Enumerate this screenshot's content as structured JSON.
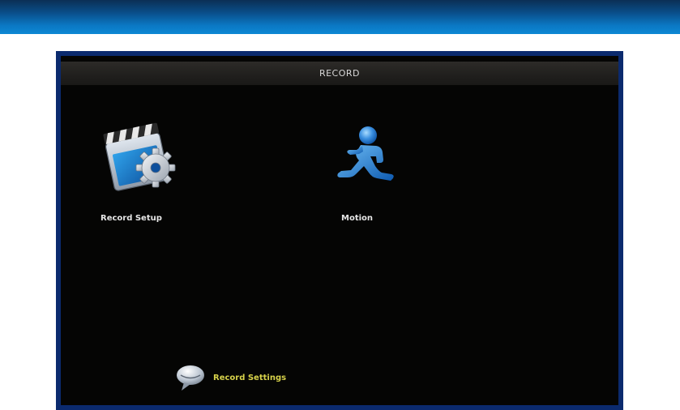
{
  "window": {
    "title": "RECORD"
  },
  "menu": {
    "items": [
      {
        "label": "Record Setup",
        "icon": "clapperboard-gear-icon"
      },
      {
        "label": "Motion",
        "icon": "running-man-icon"
      }
    ]
  },
  "hint": {
    "text": "Record Settings",
    "icon": "speech-bubble-icon"
  },
  "colors": {
    "banner": "#0b78c4",
    "frame": "#0b2a6e",
    "screen": "#050504",
    "hint_text": "#d6d14a"
  }
}
